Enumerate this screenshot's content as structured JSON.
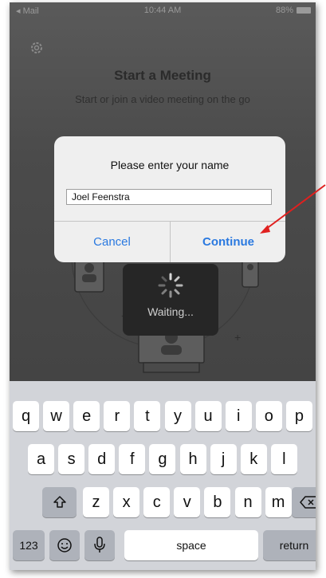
{
  "status_bar": {
    "back_label": "◂ Mail",
    "time": "10:44 AM",
    "battery": "88%"
  },
  "header": {
    "title": "Start a Meeting",
    "subtitle": "Start or join a video meeting on the go"
  },
  "hud": {
    "label": "Waiting..."
  },
  "dialog": {
    "prompt": "Please enter your name",
    "name_value": "Joel Feenstra",
    "cancel_label": "Cancel",
    "continue_label": "Continue"
  },
  "keyboard": {
    "row1": [
      "q",
      "w",
      "e",
      "r",
      "t",
      "y",
      "u",
      "i",
      "o",
      "p"
    ],
    "row2": [
      "a",
      "s",
      "d",
      "f",
      "g",
      "h",
      "j",
      "k",
      "l"
    ],
    "row3": [
      "z",
      "x",
      "c",
      "v",
      "b",
      "n",
      "m"
    ],
    "numbers_label": "123",
    "space_label": "space",
    "return_label": "return"
  },
  "colors": {
    "accent": "#2a79e0",
    "annotation": "#e0201f",
    "keyboard_bg": "#d2d4d9"
  },
  "icons": [
    "gear-icon",
    "spinner-icon",
    "shift-icon",
    "backspace-icon",
    "emoji-icon",
    "microphone-icon"
  ]
}
